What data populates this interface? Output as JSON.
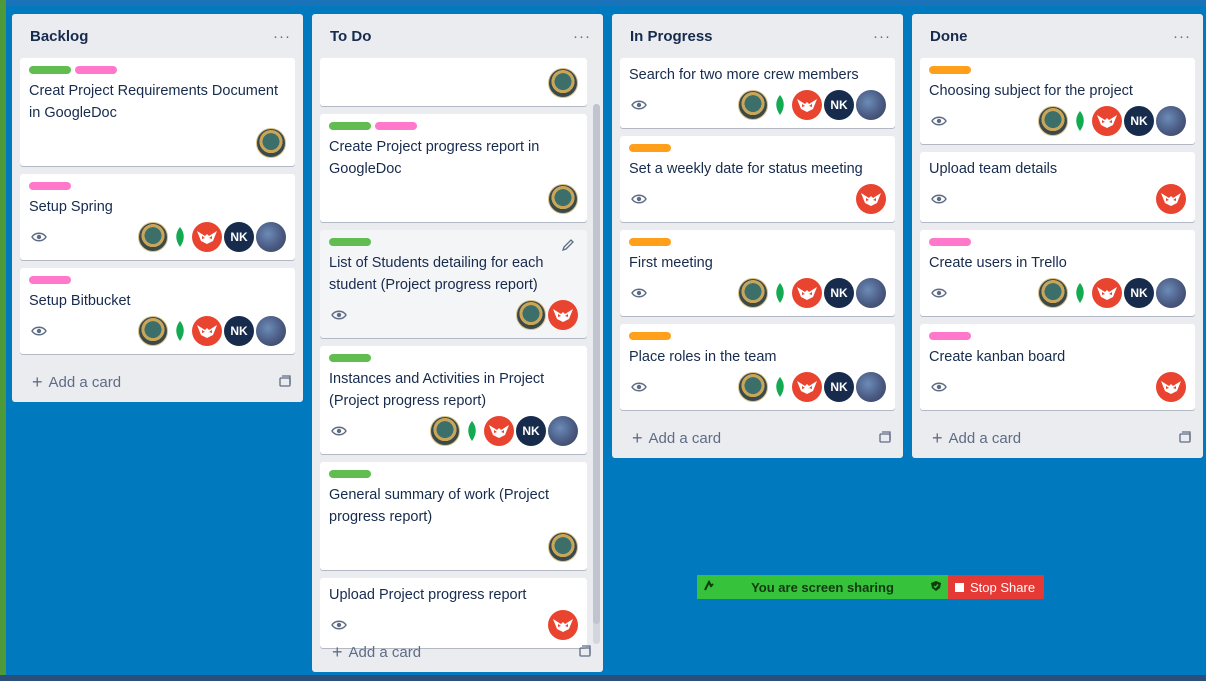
{
  "colors": {
    "board_bg": "#0079bf",
    "label_green": "#61bd4f",
    "label_pink": "#ff78cb",
    "label_orange": "#ff9f1a"
  },
  "list_menu_glyph": "···",
  "add_card_label": "Add a card",
  "lists": [
    {
      "title": "Backlog",
      "cards": [
        {
          "labels": [
            "green",
            "pink"
          ],
          "title": "Creat Project Requirements Document in GoogleDoc",
          "watch": false,
          "members": [
            "photo"
          ]
        },
        {
          "labels": [
            "pink"
          ],
          "title": "Setup Spring",
          "watch": true,
          "members": [
            "photo",
            "leaf",
            "red",
            "nk",
            "ghost"
          ]
        },
        {
          "labels": [
            "pink"
          ],
          "title": "Setup Bitbucket",
          "watch": true,
          "members": [
            "photo",
            "leaf",
            "red",
            "nk",
            "ghost"
          ]
        }
      ]
    },
    {
      "title": "To Do",
      "cards": [
        {
          "labels": [],
          "title": "",
          "watch": false,
          "members": [
            "photo"
          ]
        },
        {
          "labels": [
            "green",
            "pink"
          ],
          "title": "Create Project progress report in GoogleDoc",
          "watch": false,
          "members": [
            "photo"
          ]
        },
        {
          "labels": [
            "green"
          ],
          "title": "List of Students detailing for each student (Project progress report)",
          "watch": true,
          "members": [
            "photo",
            "red"
          ],
          "hovered": true
        },
        {
          "labels": [
            "green"
          ],
          "title": "Instances and Activities in Project (Project progress report)",
          "watch": true,
          "members": [
            "photo",
            "leaf",
            "red",
            "nk",
            "ghost"
          ]
        },
        {
          "labels": [
            "green"
          ],
          "title": "General summary of work (Project progress report)",
          "watch": false,
          "members": [
            "photo"
          ]
        },
        {
          "labels": [],
          "title": "Upload Project progress report",
          "watch": true,
          "members": [
            "red"
          ]
        }
      ]
    },
    {
      "title": "In Progress",
      "cards": [
        {
          "labels": [],
          "title": "Search for two more crew members",
          "watch": true,
          "members": [
            "photo",
            "leaf",
            "red",
            "nk",
            "ghost"
          ]
        },
        {
          "labels": [
            "orange"
          ],
          "title": "Set a weekly date for status meeting",
          "watch": true,
          "members": [
            "red"
          ]
        },
        {
          "labels": [
            "orange"
          ],
          "title": "First meeting",
          "watch": true,
          "members": [
            "photo",
            "leaf",
            "red",
            "nk",
            "ghost"
          ]
        },
        {
          "labels": [
            "orange"
          ],
          "title": "Place roles in the team",
          "watch": true,
          "members": [
            "photo",
            "leaf",
            "red",
            "nk",
            "ghost"
          ]
        }
      ]
    },
    {
      "title": "Done",
      "cards": [
        {
          "labels": [
            "orange"
          ],
          "title": "Choosing subject for the project",
          "watch": true,
          "members": [
            "photo",
            "leaf",
            "red",
            "nk",
            "ghost"
          ]
        },
        {
          "labels": [],
          "title": "Upload team details",
          "watch": true,
          "members": [
            "red"
          ]
        },
        {
          "labels": [
            "pink"
          ],
          "title": "Create users in Trello",
          "watch": true,
          "members": [
            "photo",
            "leaf",
            "red",
            "nk",
            "ghost"
          ]
        },
        {
          "labels": [
            "pink"
          ],
          "title": "Create kanban board",
          "watch": true,
          "members": [
            "red"
          ]
        }
      ]
    }
  ],
  "nk_initials": "NK",
  "screen_share": {
    "status": "You are screen sharing",
    "stop_label": "Stop Share"
  }
}
